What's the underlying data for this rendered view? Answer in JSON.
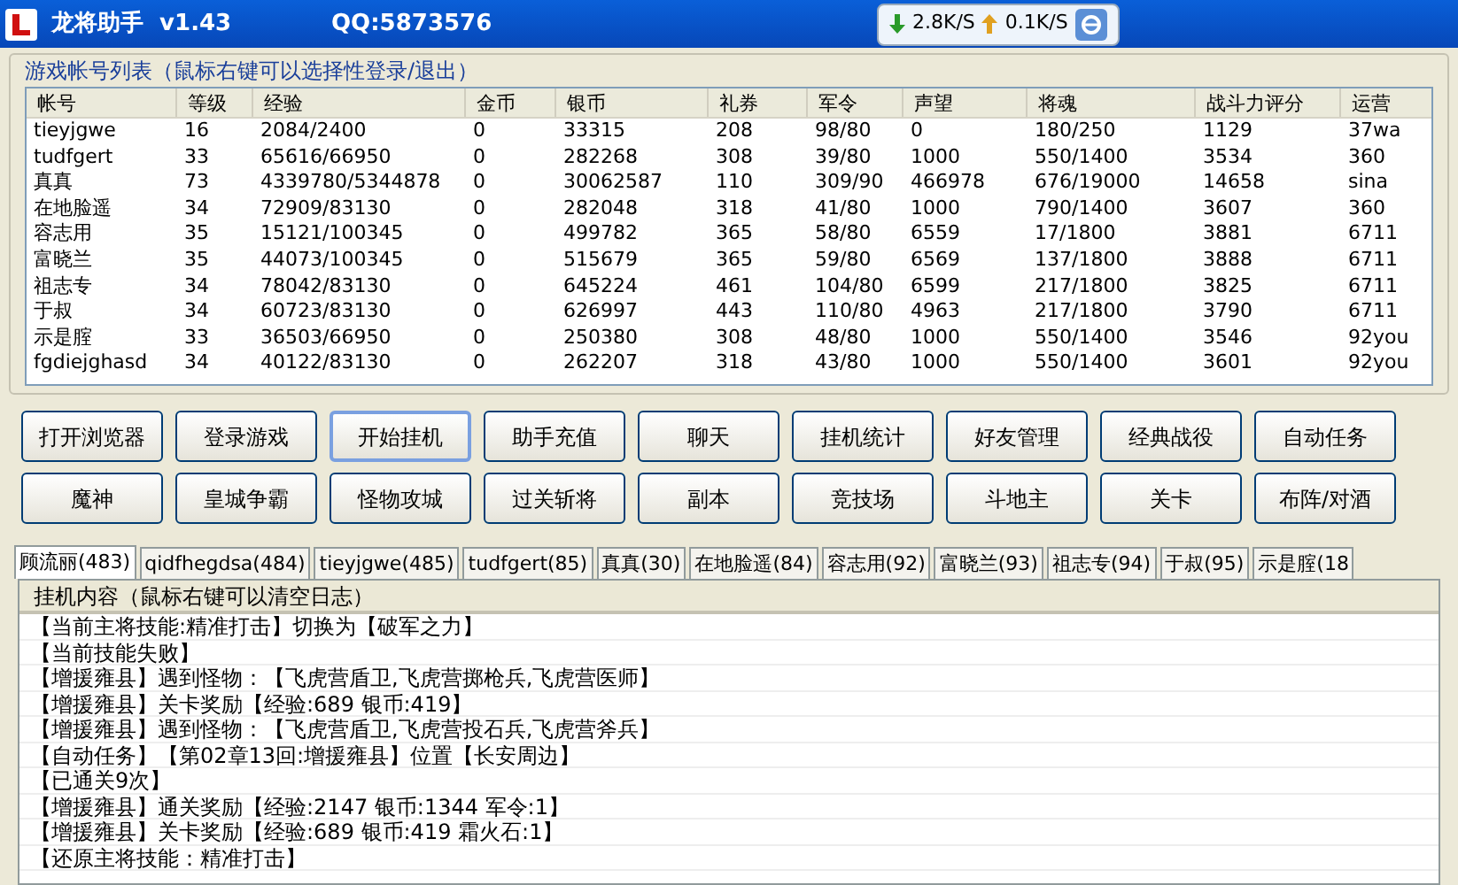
{
  "window": {
    "title": "龙将助手  v1.43",
    "qq": "QQ:5873576"
  },
  "net": {
    "down": "2.8K/S",
    "up": "0.1K/S"
  },
  "accounts": {
    "title": "游戏帐号列表（鼠标右键可以选择性登录/退出）",
    "columns": [
      "帐号",
      "等级",
      "经验",
      "金币",
      "银币",
      "礼券",
      "军令",
      "声望",
      "将魂",
      "战斗力评分",
      "运营"
    ],
    "rows": [
      [
        "tieyjgwe",
        "16",
        "2084/2400",
        "0",
        "33315",
        "208",
        "98/80",
        "0",
        "180/250",
        "1129",
        "37wa"
      ],
      [
        "tudfgert",
        "33",
        "65616/66950",
        "0",
        "282268",
        "308",
        "39/80",
        "1000",
        "550/1400",
        "3534",
        "360"
      ],
      [
        "真真",
        "73",
        "4339780/5344878",
        "0",
        "30062587",
        "110",
        "309/90",
        "466978",
        "676/19000",
        "14658",
        "sina"
      ],
      [
        "在地脸遥",
        "34",
        "72909/83130",
        "0",
        "282048",
        "318",
        "41/80",
        "1000",
        "790/1400",
        "3607",
        "360"
      ],
      [
        "容志用",
        "35",
        "15121/100345",
        "0",
        "499782",
        "365",
        "58/80",
        "6559",
        "17/1800",
        "3881",
        "6711"
      ],
      [
        "富晓兰",
        "35",
        "44073/100345",
        "0",
        "515679",
        "365",
        "59/80",
        "6569",
        "137/1800",
        "3888",
        "6711"
      ],
      [
        "祖志专",
        "34",
        "78042/83130",
        "0",
        "645224",
        "461",
        "104/80",
        "6599",
        "217/1800",
        "3825",
        "6711"
      ],
      [
        "于叔",
        "34",
        "60723/83130",
        "0",
        "626997",
        "443",
        "110/80",
        "4963",
        "217/1800",
        "3790",
        "6711"
      ],
      [
        "示是腟",
        "33",
        "36503/66950",
        "0",
        "250380",
        "308",
        "48/80",
        "1000",
        "550/1400",
        "3546",
        "92you"
      ],
      [
        "fgdiejghasd",
        "34",
        "40122/83130",
        "0",
        "262207",
        "318",
        "43/80",
        "1000",
        "550/1400",
        "3601",
        "92you"
      ]
    ]
  },
  "buttons": [
    {
      "label": "打开浏览器",
      "focused": false
    },
    {
      "label": "登录游戏",
      "focused": false
    },
    {
      "label": "开始挂机",
      "focused": true
    },
    {
      "label": "助手充值",
      "focused": false
    },
    {
      "label": "聊天",
      "focused": false
    },
    {
      "label": "挂机统计",
      "focused": false
    },
    {
      "label": "好友管理",
      "focused": false
    },
    {
      "label": "经典战役",
      "focused": false
    },
    {
      "label": "自动任务",
      "focused": false
    },
    {
      "label": "魔神",
      "focused": false
    },
    {
      "label": "皇城争霸",
      "focused": false
    },
    {
      "label": "怪物攻城",
      "focused": false
    },
    {
      "label": "过关斩将",
      "focused": false
    },
    {
      "label": "副本",
      "focused": false
    },
    {
      "label": "竞技场",
      "focused": false
    },
    {
      "label": "斗地主",
      "focused": false
    },
    {
      "label": "关卡",
      "focused": false
    },
    {
      "label": "布阵/对酒",
      "focused": false
    }
  ],
  "tabs": [
    {
      "label": "顾流丽(483)",
      "selected": true
    },
    {
      "label": "qidfhegdsa(484)",
      "selected": false
    },
    {
      "label": "tieyjgwe(485)",
      "selected": false
    },
    {
      "label": "tudfgert(85)",
      "selected": false
    },
    {
      "label": "真真(30)",
      "selected": false
    },
    {
      "label": "在地脸遥(84)",
      "selected": false
    },
    {
      "label": "容志用(92)",
      "selected": false
    },
    {
      "label": "富晓兰(93)",
      "selected": false
    },
    {
      "label": "祖志专(94)",
      "selected": false
    },
    {
      "label": "于叔(95)",
      "selected": false
    },
    {
      "label": "示是腟(18",
      "selected": false
    }
  ],
  "log": {
    "title": "挂机内容（鼠标右键可以清空日志）",
    "lines": [
      "【当前主将技能:精准打击】切换为【破军之力】",
      "【当前技能失败】",
      "【增援雍县】遇到怪物：【飞虎营盾卫,飞虎营掷枪兵,飞虎营医师】",
      "【增援雍县】关卡奖励【经验:689 银币:419】",
      "【增援雍县】遇到怪物：【飞虎营盾卫,飞虎营投石兵,飞虎营斧兵】",
      "【自动任务】【第02章13回:增援雍县】位置【长安周边】",
      "【已通关9次】",
      "【增援雍县】通关奖励【经验:2147 银币:1344 军令:1】",
      "【增援雍县】关卡奖励【经验:689 银币:419 霜火石:1】",
      "【还原主将技能：精准打击】"
    ]
  }
}
